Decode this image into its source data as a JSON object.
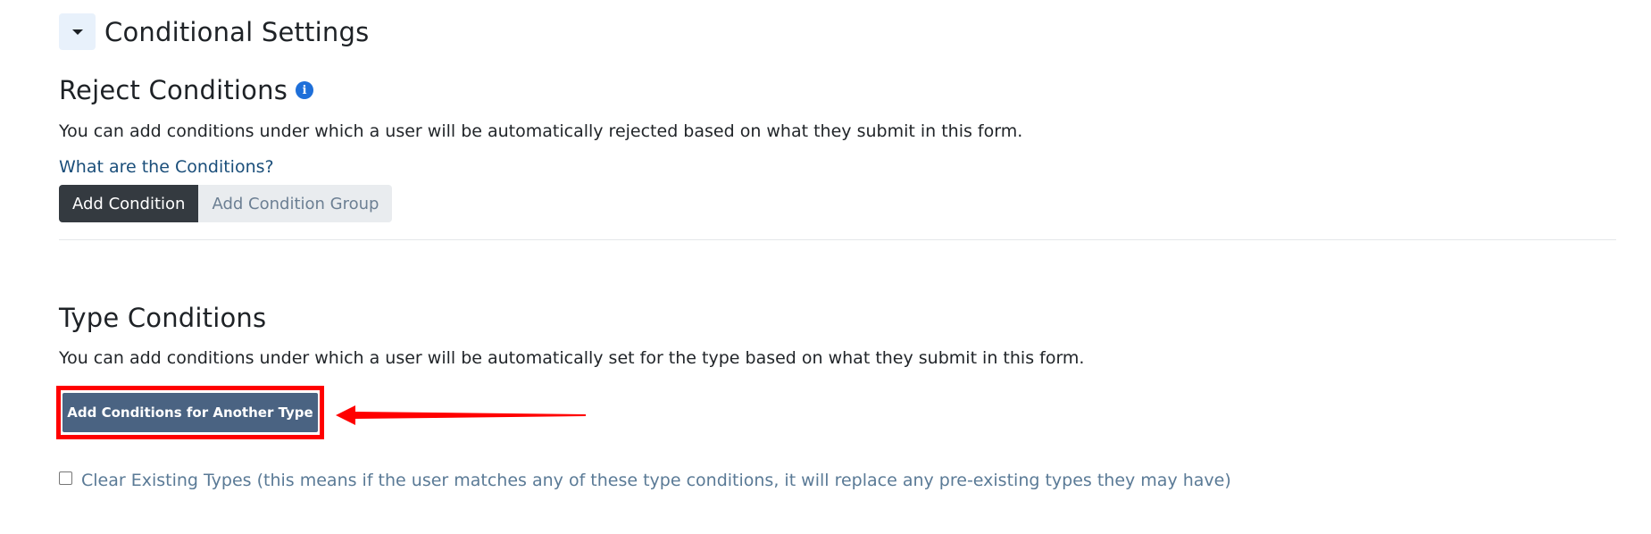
{
  "header": {
    "title": "Conditional Settings",
    "toggle_icon": "caret-down-icon"
  },
  "reject": {
    "title": "Reject Conditions",
    "info_icon": "i",
    "description": "You can add conditions under which a user will be automatically rejected based on what they submit in this form.",
    "help_link": "What are the Conditions?",
    "add_condition_label": "Add Condition",
    "add_group_label": "Add Condition Group"
  },
  "type": {
    "title": "Type Conditions",
    "description": "You can add conditions under which a user will be automatically set for the type based on what they submit in this form.",
    "add_type_label": "Add Conditions for Another Type",
    "clear_label": "Clear Existing Types (this means if the user matches any of these type conditions, it will replace any pre-existing types they may have)",
    "clear_checked": false
  },
  "colors": {
    "primary_button": "#4a6382",
    "dark_button": "#343a40",
    "highlight": "#ff0000",
    "link": "#1a4e7a",
    "info": "#1e6fd9"
  }
}
